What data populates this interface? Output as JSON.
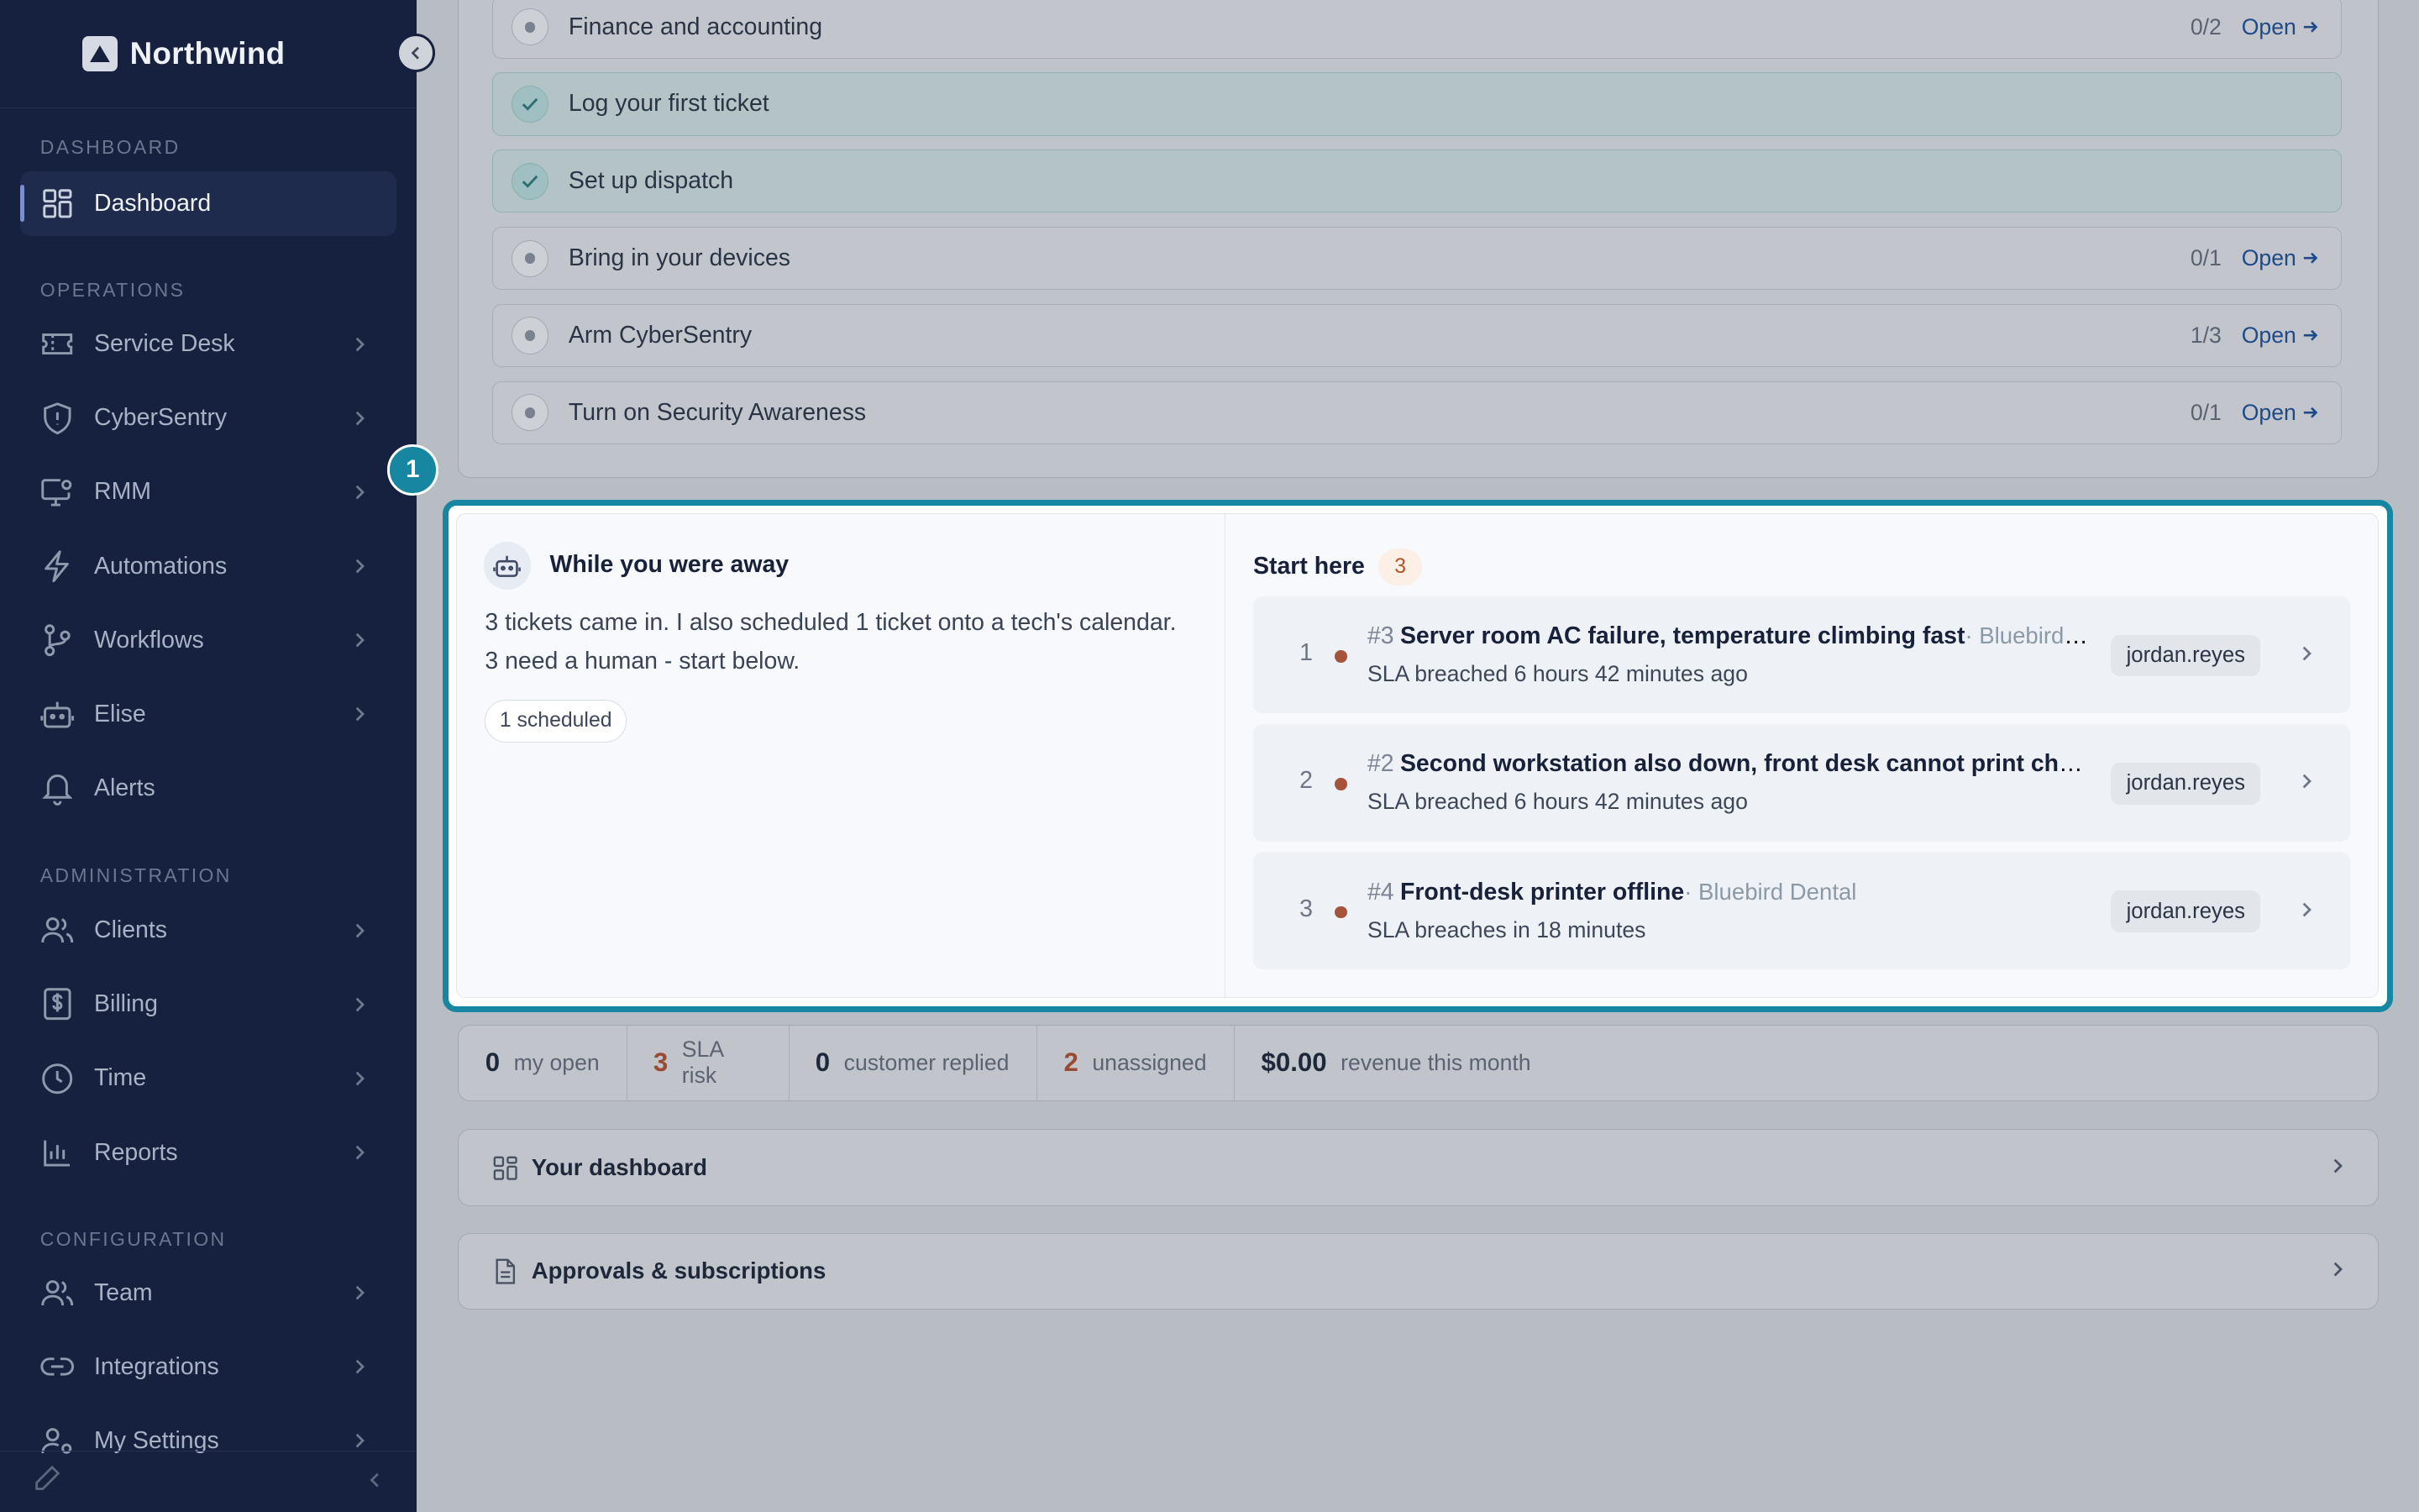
{
  "brand": {
    "name": "Northwind"
  },
  "sidebar": {
    "sections": [
      "DASHBOARD",
      "OPERATIONS",
      "ADMINISTRATION",
      "CONFIGURATION"
    ],
    "items": [
      {
        "label": "Dashboard",
        "icon": "grid-icon",
        "active": true
      },
      {
        "label": "Service Desk",
        "icon": "ticket-icon"
      },
      {
        "label": "CyberSentry",
        "icon": "shield-icon"
      },
      {
        "label": "RMM",
        "icon": "monitor-gear-icon"
      },
      {
        "label": "Automations",
        "icon": "bolt-icon"
      },
      {
        "label": "Workflows",
        "icon": "branch-icon"
      },
      {
        "label": "Elise",
        "icon": "robot-icon"
      },
      {
        "label": "Alerts",
        "icon": "bell-icon"
      },
      {
        "label": "Clients",
        "icon": "users-icon"
      },
      {
        "label": "Billing",
        "icon": "dollar-doc-icon"
      },
      {
        "label": "Time",
        "icon": "clock-icon"
      },
      {
        "label": "Reports",
        "icon": "bar-chart-icon"
      },
      {
        "label": "Team",
        "icon": "team-icon"
      },
      {
        "label": "Integrations",
        "icon": "link-icon"
      },
      {
        "label": "My Settings",
        "icon": "user-gear-icon"
      }
    ]
  },
  "checklist": [
    {
      "title": "Finance and accounting",
      "count": "0/2",
      "open": "Open",
      "done": false
    },
    {
      "title": "Log your first ticket",
      "done": true
    },
    {
      "title": "Set up dispatch",
      "done": true
    },
    {
      "title": "Bring in your devices",
      "count": "0/1",
      "open": "Open",
      "done": false
    },
    {
      "title": "Arm CyberSentry",
      "count": "1/3",
      "open": "Open",
      "done": false
    },
    {
      "title": "Turn on Security Awareness",
      "count": "0/1",
      "open": "Open",
      "done": false
    }
  ],
  "step_badge": "1",
  "away": {
    "title": "While you were away",
    "body": "3 tickets came in. I also scheduled 1 ticket onto a tech's calendar. 3 need a human - start below.",
    "pill": "1 scheduled",
    "start_title": "Start here",
    "start_count": "3",
    "tickets": [
      {
        "rank": "1",
        "id": "#3",
        "title": "Server room AC failure, temperature climbing fast",
        "client": "· Bluebird Dental",
        "sla": "SLA breached 6 hours 42 minutes ago",
        "assignee": "jordan.reyes"
      },
      {
        "rank": "2",
        "id": "#2",
        "title": "Second workstation also down, front desk cannot print chart notes",
        "client": "",
        "sla": "SLA breached 6 hours 42 minutes ago",
        "assignee": "jordan.reyes"
      },
      {
        "rank": "3",
        "id": "#4",
        "title": "Front-desk printer offline",
        "client": "· Bluebird Dental",
        "sla": "SLA breaches in 18 minutes",
        "assignee": "jordan.reyes"
      }
    ]
  },
  "stats": [
    {
      "value": "0",
      "label": "my open",
      "warn": false
    },
    {
      "value": "3",
      "label": "SLA risk",
      "warn": true
    },
    {
      "value": "0",
      "label": "customer replied",
      "warn": false
    },
    {
      "value": "2",
      "label": "unassigned",
      "warn": true
    },
    {
      "value": "$0.00",
      "label": "revenue this month",
      "warn": false
    }
  ],
  "panels": [
    {
      "title": "Your dashboard",
      "icon": "grid-icon"
    },
    {
      "title": "Approvals & subscriptions",
      "icon": "document-icon"
    }
  ],
  "colors": {
    "sidebar_bg": "#16213f",
    "accent": "#1786a0",
    "warn": "#9a4a33"
  }
}
